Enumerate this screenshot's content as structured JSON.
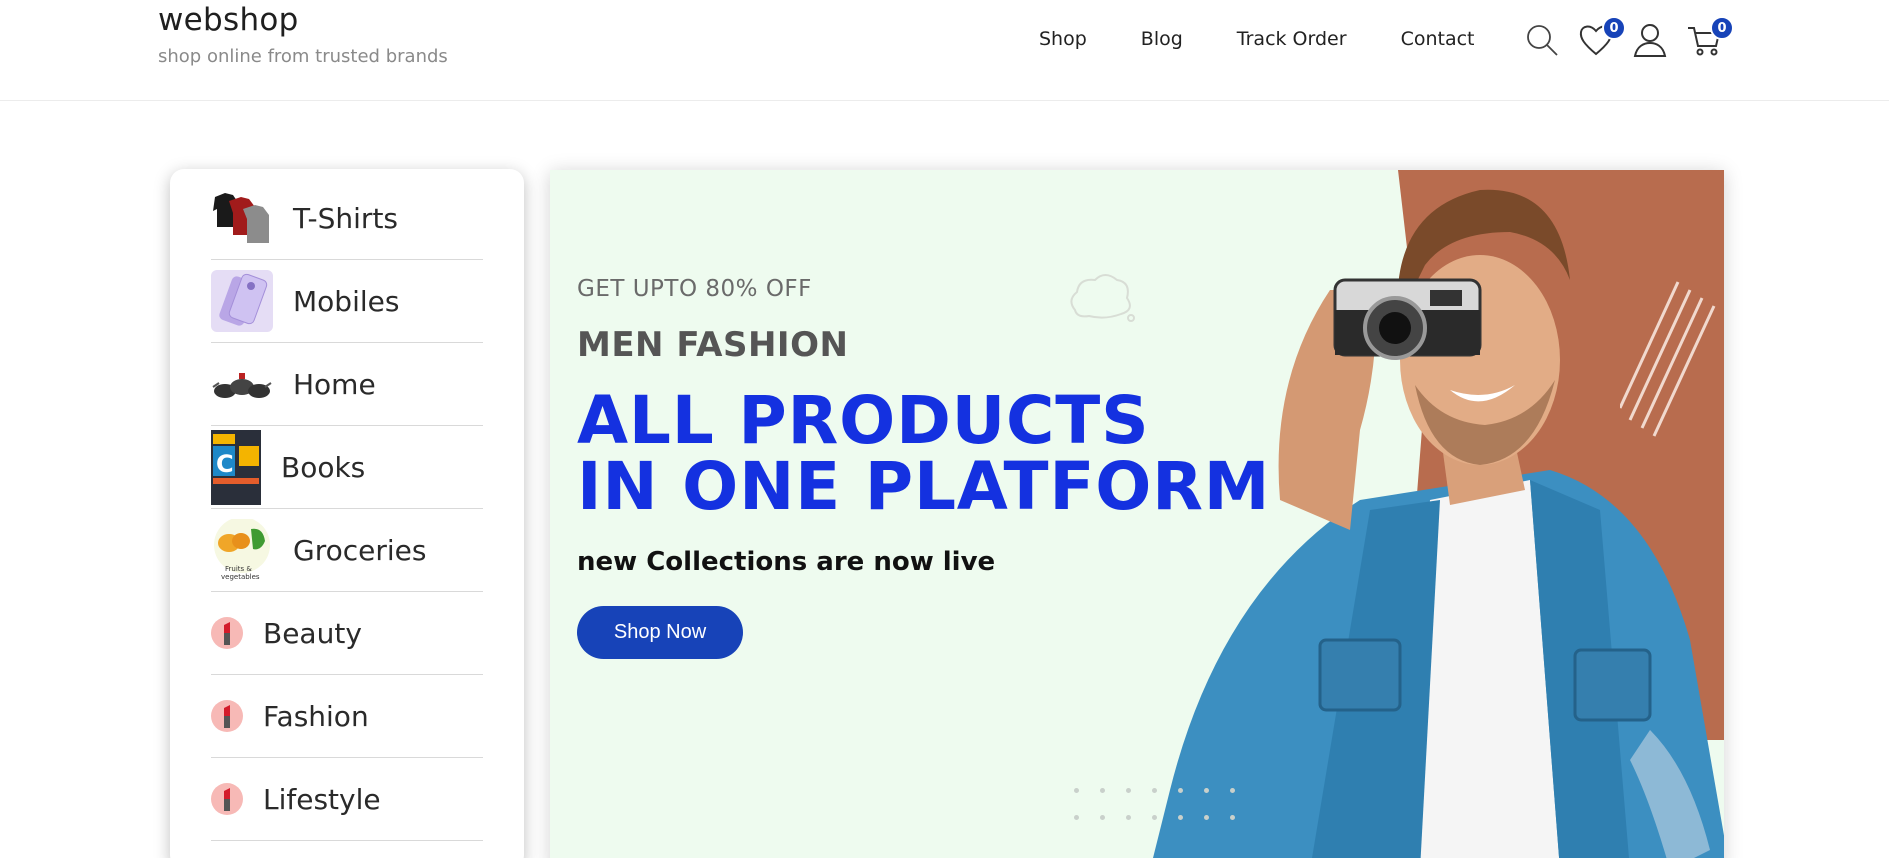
{
  "brand": {
    "name": "webshop",
    "tagline": "shop online from trusted brands"
  },
  "nav": {
    "items": [
      {
        "label": "Shop"
      },
      {
        "label": "Blog"
      },
      {
        "label": "Track Order"
      },
      {
        "label": "Contact"
      }
    ]
  },
  "header_icons": {
    "search": "search-icon",
    "wishlist": {
      "icon": "heart-icon",
      "count": "0"
    },
    "account": "user-icon",
    "cart": {
      "icon": "cart-icon",
      "count": "0"
    }
  },
  "categories": [
    {
      "label": "T-Shirts",
      "thumb": "tshirts-thumb"
    },
    {
      "label": "Mobiles",
      "thumb": "mobiles-thumb"
    },
    {
      "label": "Home",
      "thumb": "cookware-thumb"
    },
    {
      "label": "Books",
      "thumb": "books-thumb"
    },
    {
      "label": "Groceries",
      "thumb": "groceries-thumb",
      "thumb_caption": "Fruits & vegetables"
    },
    {
      "label": "Beauty",
      "thumb": "lipstick-icon"
    },
    {
      "label": "Fashion",
      "thumb": "lipstick-icon"
    },
    {
      "label": "Lifestyle",
      "thumb": "lipstick-icon"
    }
  ],
  "hero": {
    "offer": "GET UPTO 80% OFF",
    "category": "MEN FASHION",
    "title_line1": "ALL PRODUCTS",
    "title_line2": "IN ONE PLATFORM",
    "description": "new Collections are now live",
    "button": "Shop Now",
    "image": "man-with-camera-photo"
  },
  "colors": {
    "accent": "#1743b8",
    "hero_title": "#1431e0",
    "hero_bg": "#eefbef",
    "hero_accent_bg": "#b86c4e"
  }
}
